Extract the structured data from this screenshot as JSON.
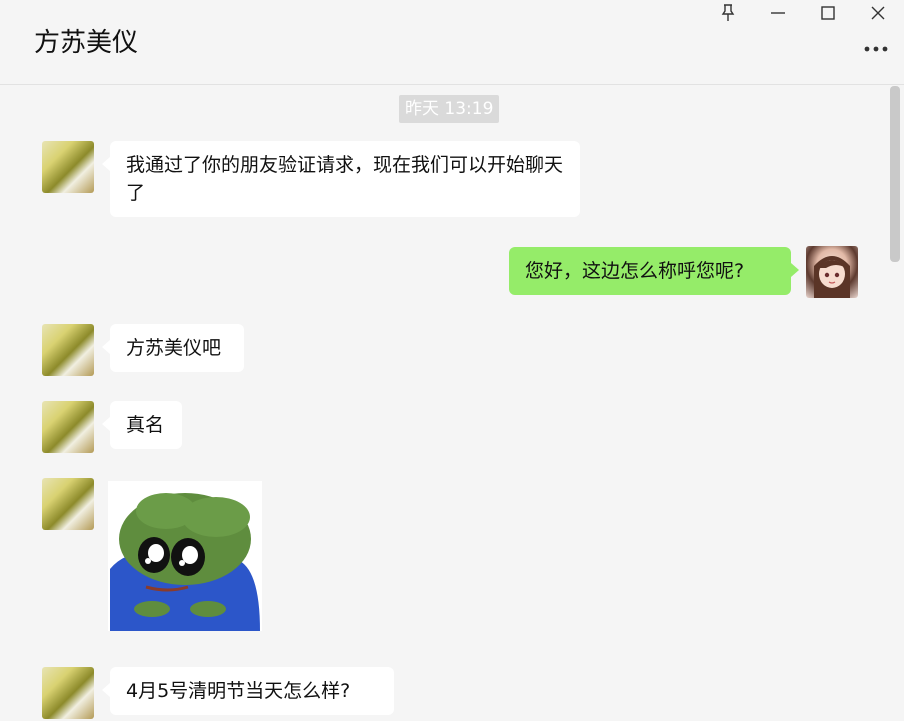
{
  "chat": {
    "title": "方苏美仪"
  },
  "window_controls": {
    "pin_icon": "pin-icon",
    "minimize_icon": "minimize-icon",
    "maximize_icon": "maximize-icon",
    "close_icon": "close-icon",
    "more_icon": "more-horizontal-icon"
  },
  "timestamp": "昨天 13:19",
  "messages": [
    {
      "sender": "contact",
      "text": "我通过了你的朋友验证请求，现在我们可以开始聊天了"
    },
    {
      "sender": "me",
      "text": "您好，这边怎么称呼您呢?"
    },
    {
      "sender": "contact",
      "text": "方苏美仪吧"
    },
    {
      "sender": "contact",
      "text": "真名"
    },
    {
      "sender": "contact",
      "type": "sticker",
      "sticker": "pepe-frog-sticker"
    },
    {
      "sender": "contact",
      "text": "4月5号清明节当天怎么样?"
    }
  ],
  "colors": {
    "background": "#f5f5f5",
    "incoming_bubble": "#ffffff",
    "outgoing_bubble": "#95ec69",
    "timestamp_bg": "#dadada"
  }
}
